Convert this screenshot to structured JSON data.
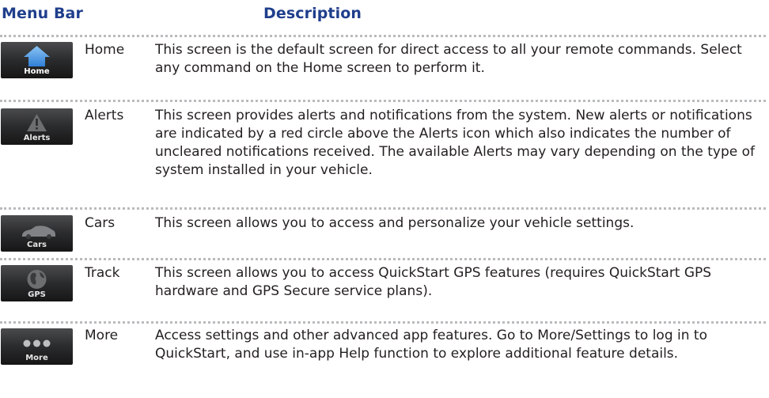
{
  "header": {
    "menu_bar": "Menu Bar",
    "description": "Description"
  },
  "rows": [
    {
      "icon": "home-icon",
      "icon_label": "Home",
      "label": "Home",
      "description": "This screen is the default screen for direct access to all your remote commands. Select any command on the Home screen to perform it."
    },
    {
      "icon": "alert-triangle-icon",
      "icon_label": "Alerts",
      "label": "Alerts",
      "description": "This screen provides alerts and notifications from the system. New alerts or notifications are indicated by a red circle above the Alerts icon which also indicates the number of uncleared notifications received. The available Alerts may vary depending on the type of system installed in your vehicle."
    },
    {
      "icon": "car-icon",
      "icon_label": "Cars",
      "label": "Cars",
      "description": "This screen allows you to access and personalize your vehicle settings."
    },
    {
      "icon": "globe-icon",
      "icon_label": "GPS",
      "label": "Track",
      "description": "This screen allows you to access QuickStart GPS features (requires QuickStart GPS hardware and GPS Secure service plans)."
    },
    {
      "icon": "more-dots-icon",
      "icon_label": "More",
      "label": "More",
      "description": "Access settings and other advanced app features. Go to More/Settings to log in to QuickStart, and use in-app Help function to explore additional feature details."
    }
  ],
  "colors": {
    "header": "#1f3e8c",
    "divider": "#b9bbbd",
    "home_icon": "#3d8fe0",
    "icon_bg": "#2a2b2c"
  }
}
